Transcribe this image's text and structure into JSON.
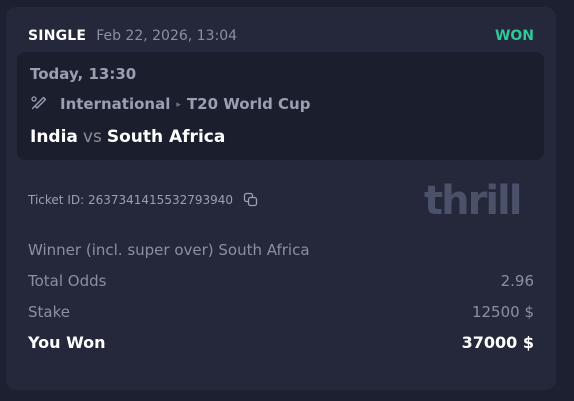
{
  "bet": {
    "type": "SINGLE",
    "placed_at": "Feb 22, 2026, 13:04",
    "status": "WON",
    "status_color": "#2cc99a"
  },
  "event": {
    "time": "Today, 13:30",
    "sport_icon": "cricket-icon",
    "category": "International",
    "tournament": "T20 World Cup",
    "home_team": "India",
    "vs": "vs",
    "away_team": "South Africa"
  },
  "ticket": {
    "label": "Ticket ID:",
    "id": "2637341415532793940",
    "copy_icon": "copy-icon"
  },
  "brand": {
    "logo_text": "thrill"
  },
  "details": {
    "selection": "Winner (incl. super over) South Africa",
    "total_odds_label": "Total Odds",
    "total_odds_value": "2.96",
    "stake_label": "Stake",
    "stake_value": "12500 $",
    "won_label": "You Won",
    "won_value": "37000 $"
  }
}
